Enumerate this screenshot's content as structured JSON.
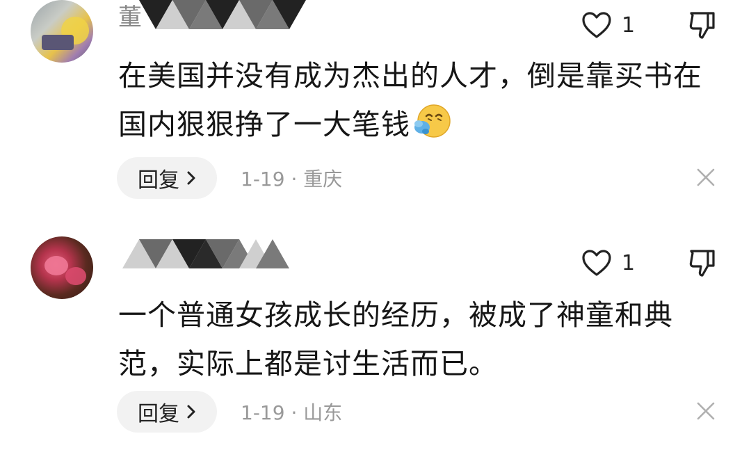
{
  "comments": [
    {
      "username_visible": "董",
      "like_count": "1",
      "text": "在美国并没有成为杰出的人才，倒是靠买书在国内狠狠挣了一大笔钱",
      "emoji": "face-with-steam-emoji",
      "reply_label": "回复",
      "date": "1-19",
      "location": "重庆"
    },
    {
      "username_visible": "",
      "like_count": "1",
      "text": "一个普通女孩成长的经历，被成了神童和典范，实际上都是讨生活而已。",
      "reply_label": "回复",
      "date": "1-19",
      "location": "山东"
    }
  ],
  "icons": {
    "like": "heart-outline-icon",
    "dislike": "thumbs-down-outline-icon",
    "reply_arrow": "chevron-right-icon",
    "close": "close-x-icon"
  },
  "colors": {
    "text": "#161616",
    "meta": "#999999",
    "reply_bg": "#f2f2f2"
  }
}
